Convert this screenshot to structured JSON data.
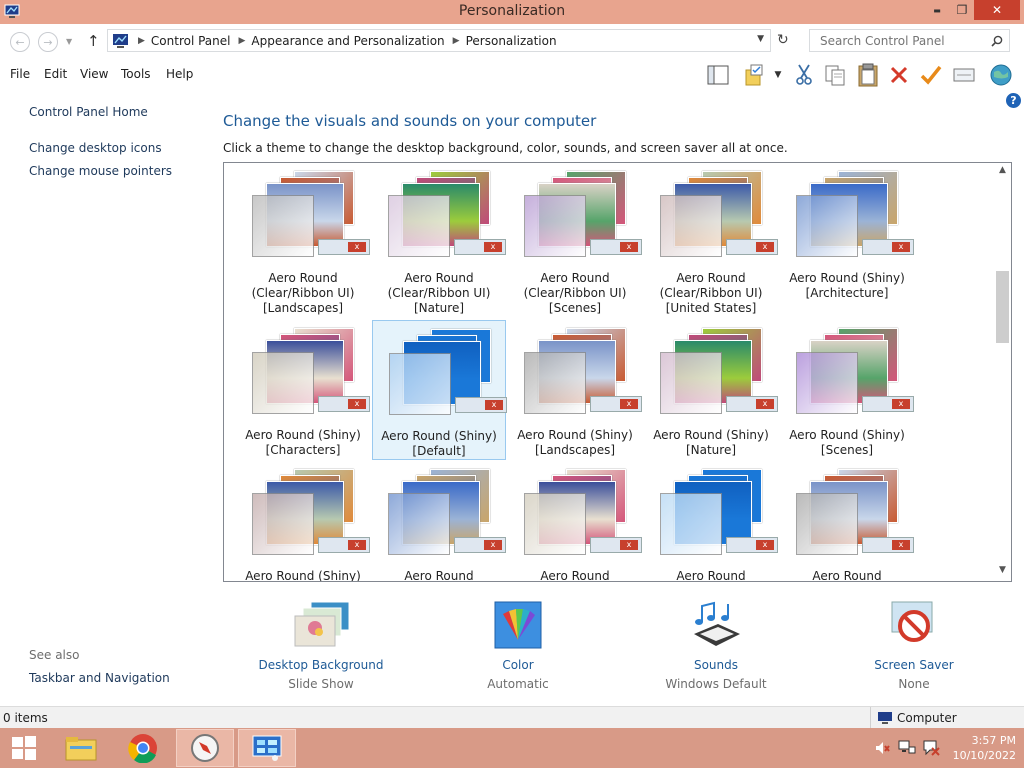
{
  "window": {
    "title": "Personalization",
    "controls": {
      "minimize": "▬",
      "maximize": "❐",
      "close": "✕"
    }
  },
  "address": {
    "crumbs": [
      "Control Panel",
      "Appearance and Personalization",
      "Personalization"
    ],
    "search_placeholder": "Search Control Panel"
  },
  "menu": [
    "File",
    "Edit",
    "View",
    "Tools",
    "Help"
  ],
  "toolbar_icons": [
    "layout-icon",
    "folder-options-icon",
    "dropdown-icon",
    "cut-icon",
    "copy-icon",
    "paste-icon",
    "delete-icon",
    "checkmark-icon",
    "properties-icon",
    "globe-icon",
    "help-icon"
  ],
  "left_nav": {
    "home": "Control Panel Home",
    "links": [
      "Change desktop icons",
      "Change mouse pointers"
    ],
    "see_also_title": "See also",
    "see_also": [
      "Taskbar and Navigation"
    ]
  },
  "main": {
    "heading": "Change the visuals and sounds on your computer",
    "subtext": "Click a theme to change the desktop background, color, sounds, and screen saver all at once.",
    "themes": [
      {
        "line1": "Aero Round",
        "line2": "(Clear/Ribbon UI)",
        "line3": "[Landscapes]",
        "palette": [
          "#7a93c8",
          "#c85a32",
          "#c9d7ea"
        ],
        "glass": "#b9b9b9"
      },
      {
        "line1": "Aero Round",
        "line2": "(Clear/Ribbon UI)",
        "line3": "[Nature]",
        "palette": [
          "#2a8a6a",
          "#c04a7a",
          "#9ccc3c"
        ],
        "glass": "#d7c4dc"
      },
      {
        "line1": "Aero Round",
        "line2": "(Clear/Ribbon UI)",
        "line3": "[Scenes]",
        "palette": [
          "#d9d2c6",
          "#d4567a",
          "#56a46a"
        ],
        "glass": "#b69ad2"
      },
      {
        "line1": "Aero Round",
        "line2": "(Clear/Ribbon UI)",
        "line3": "[United States]",
        "palette": [
          "#3c5aa8",
          "#e08a3a",
          "#b7c9b0"
        ],
        "glass": "#cdb8b8"
      },
      {
        "line1": "Aero Round (Shiny)",
        "line2": "[Architecture]",
        "line3": "",
        "palette": [
          "#3a6ac8",
          "#c9a56a",
          "#9bb3d6"
        ],
        "glass": "#6f92cf"
      },
      {
        "line1": "Aero Round (Shiny)",
        "line2": "[Characters]",
        "line3": "",
        "palette": [
          "#3a4e9a",
          "#d4567a",
          "#e8e0d0"
        ],
        "glass": "#cfc9b8"
      },
      {
        "line1": "Aero Round (Shiny)",
        "line2": "[Default]",
        "line3": "",
        "palette": [
          "#1060c0",
          "#1a78d8",
          "#1a78d8"
        ],
        "glass": "#a7ccf0"
      },
      {
        "line1": "Aero Round (Shiny)",
        "line2": "[Landscapes]",
        "line3": "",
        "palette": [
          "#7a93c8",
          "#c85a32",
          "#c9d7ea"
        ],
        "glass": "#a8a8a8"
      },
      {
        "line1": "Aero Round (Shiny)",
        "line2": "[Nature]",
        "line3": "",
        "palette": [
          "#2a8a6a",
          "#c04a7a",
          "#9ccc3c"
        ],
        "glass": "#d2b8cc"
      },
      {
        "line1": "Aero Round (Shiny)",
        "line2": "[Scenes]",
        "line3": "",
        "palette": [
          "#d9d2c6",
          "#d4567a",
          "#56a46a"
        ],
        "glass": "#a987d6"
      },
      {
        "line1": "Aero Round (Shiny)",
        "line2": "",
        "line3": "",
        "palette": [
          "#3c5aa8",
          "#e08a3a",
          "#b7c9b0"
        ],
        "glass": "#c2aaaa"
      },
      {
        "line1": "Aero Round",
        "line2": "",
        "line3": "",
        "palette": [
          "#3a6ac8",
          "#c9a56a",
          "#9bb3d6"
        ],
        "glass": "#6f92cf"
      },
      {
        "line1": "Aero Round",
        "line2": "",
        "line3": "",
        "palette": [
          "#3a4e9a",
          "#d4567a",
          "#e8e0d0"
        ],
        "glass": "#d2ccbc"
      },
      {
        "line1": "Aero Round",
        "line2": "",
        "line3": "",
        "palette": [
          "#1060c0",
          "#1a78d8",
          "#1a78d8"
        ],
        "glass": "#b6d8f4"
      },
      {
        "line1": "Aero Round",
        "line2": "",
        "line3": "",
        "palette": [
          "#7a93c8",
          "#c85a32",
          "#c9d7ea"
        ],
        "glass": "#a8a8a8"
      }
    ],
    "selected_theme_index": 6
  },
  "bottom_settings": [
    {
      "label": "Desktop Background",
      "value": "Slide Show",
      "icon": "desktop-background-icon"
    },
    {
      "label": "Color",
      "value": "Automatic",
      "icon": "color-icon"
    },
    {
      "label": "Sounds",
      "value": "Windows Default",
      "icon": "sounds-icon"
    },
    {
      "label": "Screen Saver",
      "value": "None",
      "icon": "screen-saver-icon"
    }
  ],
  "status": {
    "items": "0 items",
    "location": "Computer"
  },
  "taskbar": {
    "apps": [
      "start-icon",
      "file-explorer-icon",
      "chrome-icon",
      "compass-icon",
      "control-panel-icon"
    ],
    "time": "3:57 PM",
    "date": "10/10/2022"
  },
  "colors": {
    "accent": "#1e5a96",
    "titlebar": "#e8a48e",
    "taskbar": "#d89a87",
    "close": "#c7402d"
  }
}
